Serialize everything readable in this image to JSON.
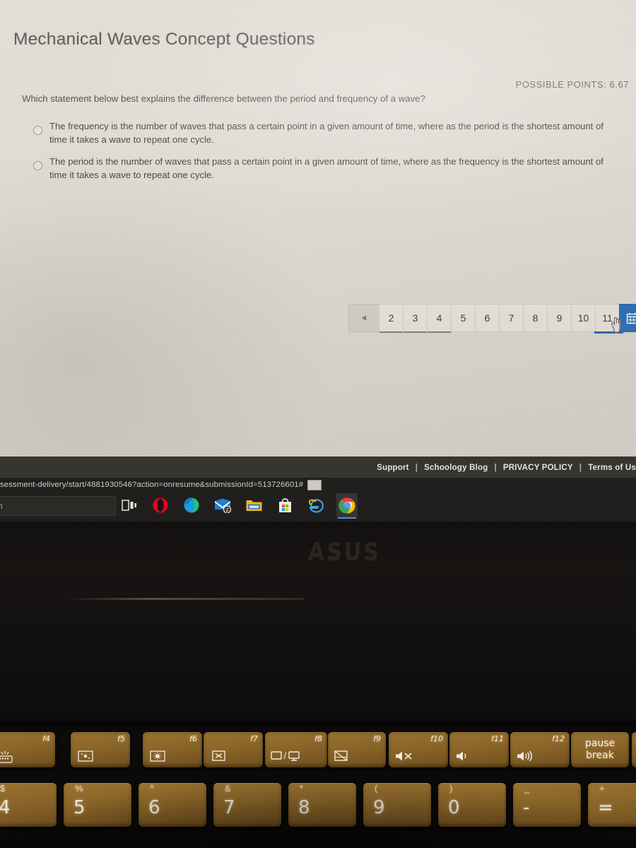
{
  "assessment": {
    "title": "Mechanical Waves Concept Questions",
    "possible_points_label": "POSSIBLE POINTS: 6.67",
    "question_prompt": "Which statement below best explains the difference between the period and frequency of a wave?",
    "options": [
      {
        "text": "The frequency is the number of waves that pass a certain point in a given amount of time, where as the period is the shortest amount of time it takes a wave to repeat one cycle.",
        "selected": false
      },
      {
        "text": "The period is the number of waves that pass a certain point in a given amount of time, where as the frequency is the shortest amount of time it takes a wave to repeat one cycle.",
        "selected": false
      }
    ]
  },
  "pagination": {
    "prev_icon": "triangle-left-icon",
    "pages": [
      "2",
      "3",
      "4",
      "5",
      "6",
      "7",
      "8",
      "9",
      "10",
      "11"
    ],
    "current_page": "11",
    "submit_icon": "calendar-grid-icon",
    "accent_color": "#2f71ba"
  },
  "footer": {
    "links": [
      {
        "label": "Support"
      },
      {
        "label": "Schoology Blog"
      },
      {
        "label": "PRIVACY POLICY"
      },
      {
        "label": "Terms of Us"
      }
    ],
    "separator": "|"
  },
  "browser": {
    "url_fragment": "sessment-delivery/start/4881930546?action=onresume&submissionId=513726601#"
  },
  "taskbar": {
    "search_value": "n",
    "icons": [
      {
        "name": "task-view-icon",
        "label": "Task View",
        "active": false
      },
      {
        "name": "opera-icon",
        "label": "Opera",
        "active": false
      },
      {
        "name": "microsoft-edge-icon",
        "label": "Microsoft Edge",
        "active": false
      },
      {
        "name": "mail-icon",
        "label": "Mail",
        "active": false,
        "badge": "2"
      },
      {
        "name": "file-explorer-icon",
        "label": "File Explorer",
        "active": false
      },
      {
        "name": "microsoft-store-icon",
        "label": "Microsoft Store",
        "active": false
      },
      {
        "name": "internet-explorer-icon",
        "label": "Internet Explorer",
        "active": false
      },
      {
        "name": "google-chrome-icon",
        "label": "Google Chrome",
        "active": true
      }
    ]
  },
  "hardware": {
    "brand_logo": "ASUS",
    "function_keys": [
      {
        "label": "f4",
        "glyph": "keyboard-backlight-icon",
        "type": "icon"
      },
      {
        "label": "f5",
        "glyph": "brightness-down-icon",
        "type": "icon"
      },
      {
        "label": "f6",
        "glyph": "brightness-up-icon",
        "type": "icon"
      },
      {
        "label": "f7",
        "glyph": "display-off-icon",
        "type": "icon"
      },
      {
        "label": "f8",
        "glyph": "display-switch-icon",
        "type": "icon"
      },
      {
        "label": "f9",
        "glyph": "touchpad-toggle-icon",
        "type": "icon"
      },
      {
        "label": "f10",
        "glyph": "volume-mute-icon",
        "type": "icon"
      },
      {
        "label": "f11",
        "glyph": "volume-down-icon",
        "type": "icon"
      },
      {
        "label": "f12",
        "glyph": "volume-up-icon",
        "type": "icon"
      }
    ],
    "pause_key": {
      "line1": "pause",
      "line2": "break"
    },
    "number_keys": [
      {
        "num": "4",
        "shift": "$"
      },
      {
        "num": "5",
        "shift": "%"
      },
      {
        "num": "6",
        "shift": "^"
      },
      {
        "num": "7",
        "shift": "&"
      },
      {
        "num": "8",
        "shift": "*"
      },
      {
        "num": "9",
        "shift": "("
      },
      {
        "num": "0",
        "shift": ")"
      },
      {
        "num": "-",
        "shift": "_"
      },
      {
        "num": "=",
        "shift": "+"
      }
    ]
  }
}
